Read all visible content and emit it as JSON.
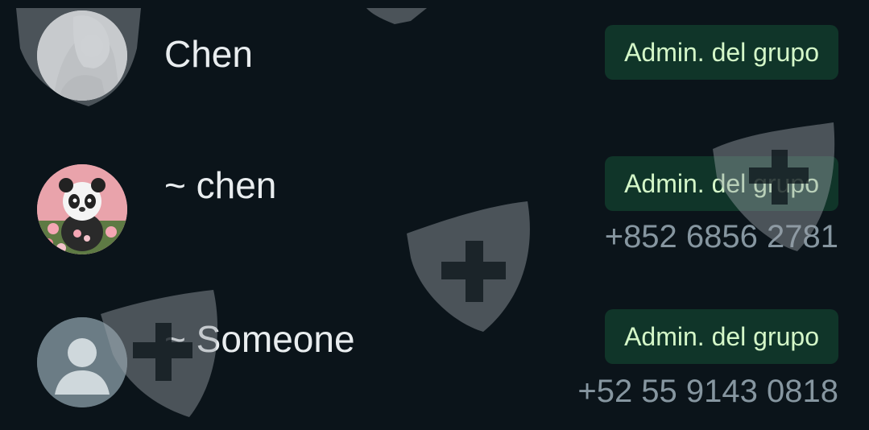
{
  "participants": [
    {
      "name": "Chen",
      "badge": "Admin. del grupo",
      "phone": "",
      "avatar": "anime-girl-avatar"
    },
    {
      "name": "~ chen",
      "badge": "Admin. del grupo",
      "phone": "+852 6856 2781",
      "avatar": "panda-avatar"
    },
    {
      "name": "~ Someone",
      "badge": "Admin. del grupo",
      "phone": "+52 55 9143 0818",
      "avatar": "default-person-avatar"
    }
  ],
  "colors": {
    "background": "#0b141a",
    "badge_bg": "#103529",
    "badge_text": "#d4f7c8",
    "name_text": "#e9edef",
    "phone_text": "#8696a0"
  }
}
